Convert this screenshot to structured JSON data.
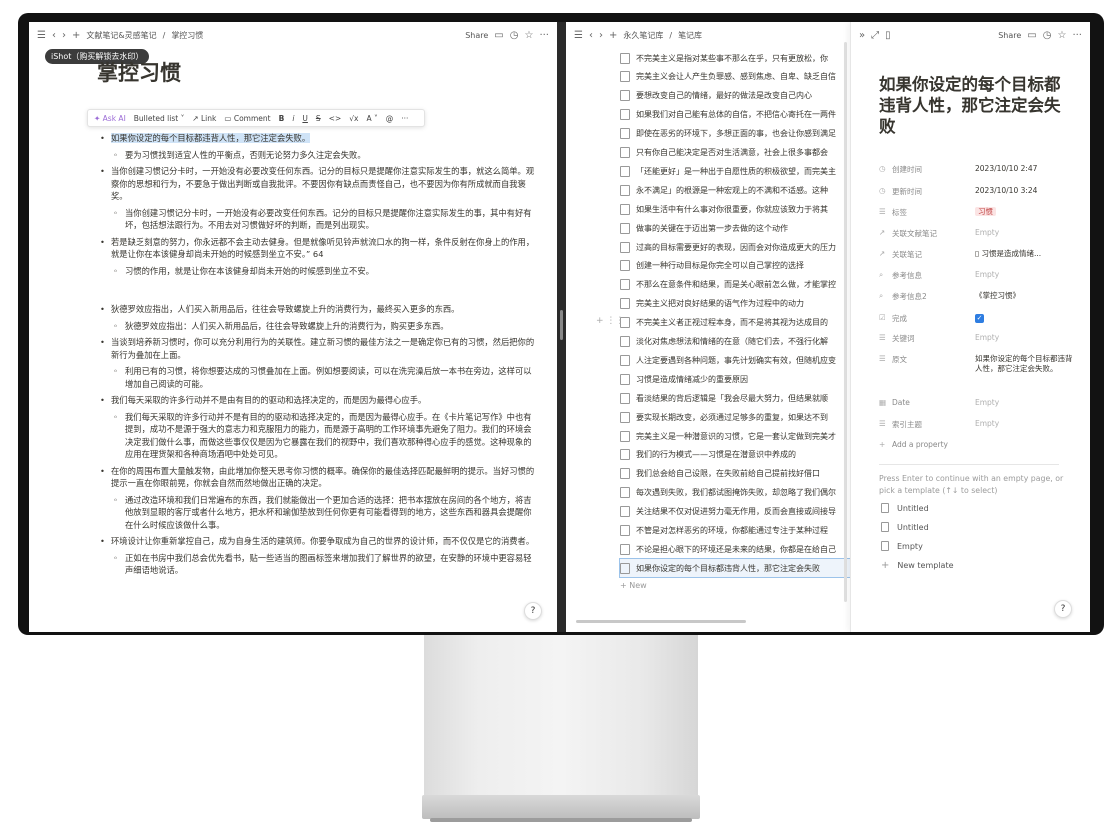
{
  "left_pane": {
    "breadcrumb": [
      "文献笔记&灵感笔记",
      "掌控习惯"
    ],
    "share_label": "Share",
    "watermark": "iShot（购买解锁去水印）",
    "title": "掌控习惯",
    "toolbar": {
      "ask_ai": "Ask AI",
      "bulleted_list": "Bulleted list",
      "link": "Link",
      "comment": "Comment",
      "bold": "B",
      "italic": "i",
      "underline": "U",
      "strike": "S",
      "code": "<>",
      "math": "√x",
      "color": "A"
    },
    "bullets": [
      {
        "level": 1,
        "text": "如果你设定的每个目标都违背人性，那它注定会失败。",
        "highlight": true
      },
      {
        "level": 2,
        "text": "要为习惯找到适宜人性的平衡点，否则无论努力多久注定会失败。"
      },
      {
        "level": 1,
        "text": "当你创建习惯记分卡时，一开始没有必要改变任何东西。记分的目标只是提醒你注意实际发生的事，就这么简单。观察你的思想和行为，不要急于做出判断或自我批评。不要因你有缺点而责怪自己，也不要因为你有所成就而自我褒奖。"
      },
      {
        "level": 2,
        "text": "当你创建习惯记分卡时，一开始没有必要改变任何东西。记分的目标只是提醒你注意实际发生的事，其中有好有坏，包括想法跟行为。不用去对习惯做好坏的判断，而是列出现实。"
      },
      {
        "level": 1,
        "text": "若是缺乏刻意的努力，你永远都不会主动去健身。但是就像听见铃声就流口水的狗一样，条件反射在你身上的作用，就是让你在本该健身却尚未开始的时候感到坐立不安。” 64"
      },
      {
        "level": 2,
        "text": "习惯的作用，就是让你在本该健身却尚未开始的时候感到坐立不安。"
      },
      {
        "level": 0,
        "text": ""
      },
      {
        "level": 1,
        "text": "狄德罗效应指出，人们买入新用品后，往往会导致螺旋上升的消费行为，最终买入更多的东西。"
      },
      {
        "level": 2,
        "text": "狄德罗效应指出：人们买入新用品后，往往会导致螺旋上升的消费行为，购买更多东西。"
      },
      {
        "level": 1,
        "text": "当谈到培养新习惯时，你可以充分利用行为的关联性。建立新习惯的最佳方法之一是确定你已有的习惯，然后把你的新行为叠加在上面。"
      },
      {
        "level": 2,
        "text": "利用已有的习惯，将你想要达成的习惯叠加在上面。例如想要阅读，可以在洗完澡后放一本书在旁边，这样可以增加自己阅读的可能。"
      },
      {
        "level": 1,
        "text": "我们每天采取的许多行动并不是由有目的的驱动和选择决定的，而是因为最得心应手。"
      },
      {
        "level": 2,
        "text": "我们每天采取的许多行动并不是有目的的驱动和选择决定的，而是因为最得心应手。在《卡片笔记写作》中也有提到，成功不是源于强大的意志力和克服阻力的能力，而是源于高明的工作环境事先避免了阻力。我们的环境会决定我们做什么事，而做这些事仅仅是因为它暴露在我们的视野中，我们喜欢那种得心应手的感觉。这种现象的应用在理货架和各种商场酒吧中处处可见。"
      },
      {
        "level": 1,
        "text": "在你的周围布置大量触发物，由此增加你整天思考你习惯的概率。确保你的最佳选择匹配最鲜明的提示。当好习惯的提示一直在你眼前晃，你就会自然而然地做出正确的决定。"
      },
      {
        "level": 2,
        "text": "通过改造环境和我们日常遍布的东西，我们就能做出一个更加合适的选择：把书本摆放在房间的各个地方，将吉他放到显眼的客厅或者什么地方，把水杯和瑜伽垫放到任何你更有可能看得到的地方，这些东西和器具会提醒你在什么时候应该做什么事。"
      },
      {
        "level": 1,
        "text": "环境设计让你重新掌控自己，成为自身生活的建筑师。你要争取成为自己的世界的设计师，而不仅仅是它的消费者。"
      },
      {
        "level": 2,
        "text": "正如在书房中我们总会优先看书，贴一些适当的图画标签来增加我们了解世界的欲望，在安静的环境中更容易轻声细语地说话。"
      }
    ],
    "help_label": "?"
  },
  "right_pane": {
    "breadcrumb": [
      "永久笔记库",
      "笔记库"
    ],
    "list_items": [
      "不完美主义是指对某些事不那么在乎，只有更放松，你",
      "完美主义会让人产生负罪感、感到焦虑、自卑、缺乏自信",
      "要想改变自己的情绪，最好的做法是改变自己内心",
      "如果我们对自己能有总体的自信，不把信心寄托在一两件",
      "即使在恶劣的环境下，多想正面的事，也会让你感到满足",
      "只有你自己能决定是否对生活满意，社会上很多事都会",
      "「还能更好」是一种出于自愿性质的积极欲望，而完美主",
      "永不满足」的根源是一种宏观上的不满和不适感。这种",
      "如果生活中有什么事对你很重要，你就应该致力于将其",
      "做事的关键在于迈出第一步去做的这个动作",
      "过高的目标需要更好的表现，因而会对你造成更大的压力",
      "创建一种行动目标是你完全可以自己掌控的选择",
      "不那么在意条件和结果，而是关心眼前怎么做，才能掌控",
      "完美主义把对良好结果的语气作为过程中的动力",
      "不完美主义者正视过程本身，而不是将其视为达成目的",
      "淡化对焦虑想法和情绪的在意（随它们去，不强行化解",
      "人注定要遇到各种问题，事先计划确实有效，但随机应变",
      "习惯是造成情绪减少的重要原因",
      "看淡结果的背后逻辑是「我会尽最大努力，但结果就顺",
      "要实现长期改变，必须通过足够多的重复，如果达不到",
      "完美主义是一种潜意识的习惯，它是一套认定做到完美才",
      "我们的行为模式——习惯是在潜意识中养成的",
      "我们总会给自己设限，在失败前给自己提前找好借口",
      "每次遇到失败，我们都试图掩饰失败，却忽略了我们偶尔",
      "关注结果不仅对促进努力毫无作用，反而会直接或间接导",
      "不管是对怎样恶劣的环境，你都能通过专注于某种过程",
      "不论是担心眼下的环境还是未来的结果，你都是在给自己",
      "如果你设定的每个目标都违背人性，那它注定会失败"
    ],
    "new_label": "New",
    "peek": {
      "share_label": "Share",
      "title": "如果你设定的每个目标都违背人性，那它注定会失败",
      "properties": [
        {
          "icon": "clock-icon",
          "key": "创建时间",
          "value": "2023/10/10 2:47",
          "type": "text"
        },
        {
          "icon": "clock-icon",
          "key": "更新时间",
          "value": "2023/10/10 3:24",
          "type": "text"
        },
        {
          "icon": "list-icon",
          "key": "标签",
          "value": "习惯",
          "type": "tag"
        },
        {
          "icon": "arrow-icon",
          "key": "关联文献笔记",
          "value": "Empty",
          "type": "empty"
        },
        {
          "icon": "arrow-icon",
          "key": "关联笔记",
          "value": "习惯是造成情绪...",
          "type": "page"
        },
        {
          "icon": "search-icon",
          "key": "参考信息",
          "value": "Empty",
          "type": "empty"
        },
        {
          "icon": "search-icon",
          "key": "参考信息2",
          "value": "《掌控习惯》",
          "type": "text"
        },
        {
          "icon": "check-icon",
          "key": "完成",
          "value": "✓",
          "type": "check"
        },
        {
          "icon": "list-icon",
          "key": "关键词",
          "value": "Empty",
          "type": "empty"
        },
        {
          "icon": "list-icon",
          "key": "原文",
          "value": "如果你设定的每个目标都违背人性，那它注定会失败。",
          "type": "text"
        },
        {
          "icon": "calendar-icon",
          "key": "Date",
          "value": "Empty",
          "type": "empty"
        },
        {
          "icon": "list-icon",
          "key": "索引主题",
          "value": "Empty",
          "type": "empty"
        }
      ],
      "add_property": "Add a property",
      "hint": "Press Enter to continue with an empty page, or pick a template (↑↓ to select)",
      "templates": [
        "Untitled",
        "Untitled",
        "Empty"
      ],
      "new_template": "New template",
      "help_label": "?"
    }
  }
}
